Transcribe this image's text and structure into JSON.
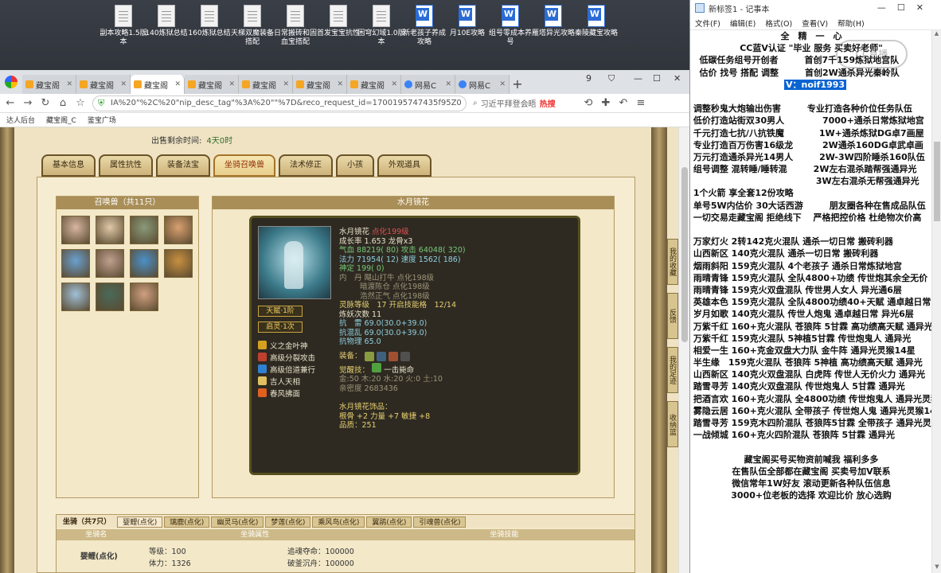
{
  "desktop": {
    "icons": [
      {
        "label": "副本攻略1.5版本",
        "type": "txt"
      },
      {
        "label": "140炼狱总结",
        "type": "txt"
      },
      {
        "label": "160炼狱总结",
        "type": "txt"
      },
      {
        "label": "天梯双魔装备搭配",
        "type": "txt"
      },
      {
        "label": "日常搬砖和固血宝搭配",
        "type": "txt"
      },
      {
        "label": "首发宝宝抗性",
        "type": "txt"
      },
      {
        "label": "困穹幻域1.0版本",
        "type": "txt"
      },
      {
        "label": "新老孩子养成攻略",
        "type": "word"
      },
      {
        "label": "月10E攻略",
        "type": "word"
      },
      {
        "label": "组号零成本养号",
        "type": "word"
      },
      {
        "label": "雁塔异光攻略",
        "type": "word"
      },
      {
        "label": "秦陵藏宝攻略",
        "type": "word"
      }
    ]
  },
  "browser": {
    "tabs": [
      {
        "label": "藏宝阁",
        "fav": "cbg",
        "active": false
      },
      {
        "label": "藏宝阁",
        "fav": "cbg",
        "active": false
      },
      {
        "label": "藏宝阁",
        "fav": "cbg",
        "active": true
      },
      {
        "label": "藏宝阁",
        "fav": "cbg",
        "active": false
      },
      {
        "label": "藏宝阁",
        "fav": "cbg",
        "active": false
      },
      {
        "label": "藏宝阁",
        "fav": "cbg",
        "active": false
      },
      {
        "label": "藏宝阁",
        "fav": "cbg",
        "active": false
      },
      {
        "label": "网易C",
        "fav": "blue",
        "active": false
      },
      {
        "label": "网易C",
        "fav": "blue",
        "active": false
      }
    ],
    "tab_count": "9",
    "url": "IA%20\"%2C%20\"nip_desc_tag\"%3A%20\"\"%7D&reco_request_id=1700195747435f95Z0",
    "hot_search": "习近平拜登会晤",
    "hot_badge": "热搜",
    "bookmarks": [
      "达人后台",
      "藏宝阁_C",
      "鉴宝广场"
    ]
  },
  "page": {
    "sale_time_label": "出售剩余时间:",
    "sale_time_value": "4天0时",
    "tabs": [
      "基本信息",
      "属性抗性",
      "装备法宝",
      "坐骑召唤兽",
      "法术修正",
      "小孩",
      "外观道具"
    ],
    "active_tab": 3,
    "pet_list_title": "召唤兽（共11只）",
    "pet_colors": [
      "#d8b6a0",
      "#e0c8a8",
      "#8a9a7a",
      "#d9a070",
      "#6aa0d0",
      "#c0a090",
      "#4a90c8",
      "#c89040",
      "#a0c0d8",
      "#4a6a5a",
      "#d0a080"
    ],
    "detail_title": "水月镜花",
    "pet": {
      "name": "水月镜花",
      "name_suffix": "点化199级",
      "growth": "成长率 1.653 龙骨x3",
      "hp": "气血 88219( 80) 攻击 64048( 320)",
      "mp": "法力 71954( 12) 速度 1562( 186)",
      "def": "神定 199( 0)",
      "dan1": "内　丹 飓山打牛 点化198级",
      "dan2": "暗渡陈仓 点化198级",
      "dan3": "浩然正气 点化198级",
      "soul": "灵脉等级　17 开启技能格　12/14",
      "tame": "炼妖次数 11",
      "resist1": "抗　雷 69.0(30.0+39.0)",
      "resist2": "抗混乱 69.0(30.0+39.0)",
      "resist3": "抗物理 65.0",
      "equip_label": "装备：",
      "awaken_label": "觉醒技：",
      "awaken_skill": "一击毙命",
      "elements": "金:50 木:20 水:20 火:0 土:10",
      "intimacy": "亲密度 2683436",
      "decor_label": "水月镜花饰品：",
      "decor1": "根骨 +2 力量 +7 敏捷 +8",
      "decor2": "品质：251",
      "tags": [
        "天赋·1阶",
        "启灵·1次"
      ],
      "skills": [
        {
          "name": "义之金叶神",
          "color": "#d4a020"
        },
        {
          "name": "高级分裂攻击",
          "color": "#c04030"
        },
        {
          "name": "高级倍道兼行",
          "color": "#3080d0"
        },
        {
          "name": "吉人天相",
          "color": "#e0c060"
        },
        {
          "name": "春风拂面",
          "color": "#e06020"
        }
      ]
    },
    "side_buttons": [
      "我的收藏",
      "反馈",
      "我的足迹",
      "收纳篮"
    ],
    "mounts": {
      "tabs": [
        "坐骑（共7只）",
        "婴鲤(点化)",
        "璃鹿(点化)",
        "幽灵马(点化)",
        "梦莲(点化)",
        "乘风鸟(点化)",
        "翼鹃(点化)",
        "引魂兽(点化)"
      ],
      "columns": [
        "坐骑名",
        "坐骑属性",
        "坐骑技能"
      ],
      "name": "婴鲤(点化)",
      "level": "等级：100",
      "stamina": "体力：1326",
      "skill1": "追魂夺命：100000",
      "skill2": "破釜沉舟：100000"
    }
  },
  "notepad": {
    "title": "新标签1 - 记事本",
    "menu": [
      "文件(F)",
      "编辑(E)",
      "格式(O)",
      "查看(V)",
      "帮助(H)"
    ],
    "watermark": "CC直播",
    "lines": [
      {
        "t": "全　精　一　心",
        "c": true
      },
      {
        "t": "CC蓝V认证 \"毕业 服务 买卖好老师\"",
        "c": true
      },
      {
        "t": "   低碳任务组号开创者　　　首创7千159炼狱地宫队",
        "c": false
      },
      {
        "t": "   估价 找号 搭配 调整　　　首创2W通杀异光秦岭队",
        "c": false
      },
      {
        "t": "",
        "c": false,
        "hl": "V：noif1993"
      },
      {
        "t": "",
        "c": false
      },
      {
        "t": " 调整秒鬼大炮输出伤害　　　专业打造各种价位任务队伍",
        "c": false
      },
      {
        "t": " 低价打造站街双30男人　　　　 7000+通杀日常炼狱地宫",
        "c": false
      },
      {
        "t": " 千元打造七抗/八抗铁魔　　　　1W+通杀炼狱DG卓7画屋",
        "c": false
      },
      {
        "t": " 专业打造百万伤害16级龙　　　 2W通杀160DG卓武卓画",
        "c": false
      },
      {
        "t": " 万元打造通杀异光14男人　　　2W-3W四阶睡杀160队伍",
        "c": false
      },
      {
        "t": " 组号调整 混转睡/睡转混　　　2W左右混杀踏帮强通异光",
        "c": false
      },
      {
        "t": "　　　　　　　　　　　　　　 3W左右混杀无帮强通异光",
        "c": false
      },
      {
        "t": " 1个火箭 享全套12份攻略",
        "c": false
      },
      {
        "t": " 单号5W内估价 30大话西游　　　朋友圈各种在售成品队伍",
        "c": false
      },
      {
        "t": " 一切交易走藏宝阁 拒绝线下　 严格把控价格 杜绝物次价高",
        "c": false
      },
      {
        "t": "",
        "c": false
      },
      {
        "t": " 万家灯火 2转142克火混队 通杀一切日常 搬砖利器",
        "c": false
      },
      {
        "t": " 山西新区 140克火混队 通杀一切日常 搬砖利器",
        "c": false
      },
      {
        "t": " 烟雨斜阳 159克火混队 4个老孩子 通杀日常炼狱地宫",
        "c": false
      },
      {
        "t": " 雨晴青锋 159克火混队 全队4800+功绩 传世炮其余全无价",
        "c": false
      },
      {
        "t": " 雨晴青锋 159克火双盘混队 传世男人女人 异光通6层",
        "c": false
      },
      {
        "t": " 英雄本色 159克火混队 全队4800功绩40+天赋 通卓越日常",
        "c": false
      },
      {
        "t": " 岁月如歌 140克火混队 传世人炮鬼 通卓越日常 异光6层",
        "c": false
      },
      {
        "t": " 万紫千红 160+克火混队 苍狼阵 5甘霖 高功绩高天赋 通异光",
        "c": false
      },
      {
        "t": " 万紫千红 159克火混队 5神植5甘霖 传世炮鬼人 通异光",
        "c": false
      },
      {
        "t": " 相爱一生 160+克金双盘大力队 金牛阵 通异光灵猴14星",
        "c": false
      },
      {
        "t": " 半生缘　159克火混队 苍狼阵 5神植 高功绩高天赋 通异光",
        "c": false
      },
      {
        "t": " 山西新区 140克火双盘混队 白虎阵 传世人无价火力 通异光",
        "c": false
      },
      {
        "t": " 踏雪寻芳 140克火双盘混队 传世炮鬼人 5甘霖 通异光",
        "c": false
      },
      {
        "t": " 把酒言欢 160+克火混队 全4800功绩 传世炮鬼人 通异光灵猴",
        "c": false
      },
      {
        "t": " 雾隐云居 160+克火混队 全带孩子 传世炮人鬼 通异光灵猴14",
        "c": false
      },
      {
        "t": " 踏雪寻芳 159克木四阶混队 苍狼阵5甘霖 全带孩子 通异光灵猴",
        "c": false
      },
      {
        "t": " 一战倾城 160+克火四阶混队 苍狼阵 5甘霖 通异光",
        "c": false
      },
      {
        "t": "",
        "c": false
      },
      {
        "t": "藏宝阁买号买物资前喊我 福利多多",
        "c": true
      },
      {
        "t": "在售队伍全部都在藏宝阁 买卖号加V联系",
        "c": true
      },
      {
        "t": "微信常年1W好友 滚动更新各种队伍信息",
        "c": true
      },
      {
        "t": "3000+位老板的选择 欢迎比价 放心选购",
        "c": true
      }
    ]
  }
}
